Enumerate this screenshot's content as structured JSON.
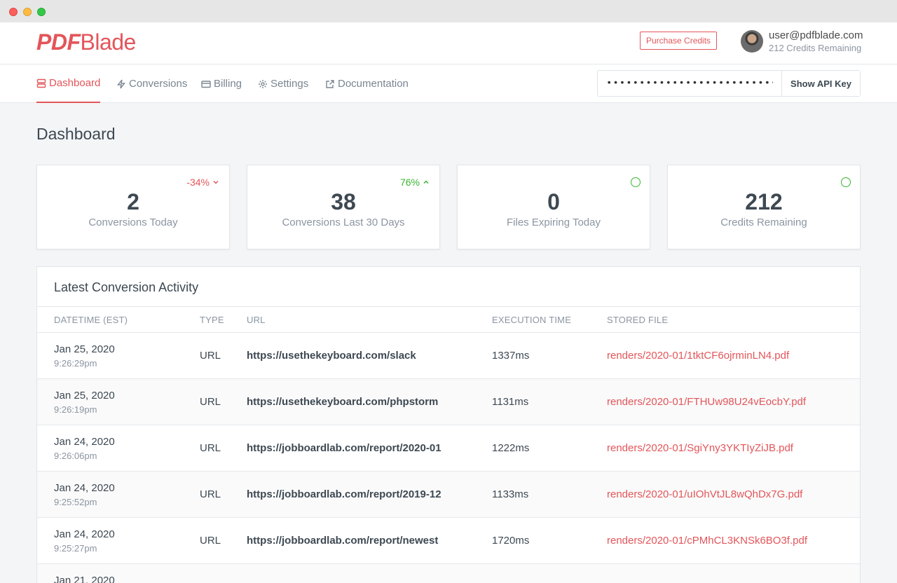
{
  "brand": {
    "part1": "PDF",
    "part2": "Blade"
  },
  "header": {
    "purchase_label": "Purchase Credits",
    "user_email": "user@pdfblade.com",
    "user_credits": "212 Credits Remaining"
  },
  "nav": {
    "items": [
      {
        "label": "Dashboard",
        "icon": "server-icon"
      },
      {
        "label": "Conversions",
        "icon": "bolt-icon"
      },
      {
        "label": "Billing",
        "icon": "credit-card-icon"
      },
      {
        "label": "Settings",
        "icon": "gear-icon"
      },
      {
        "label": "Documentation",
        "icon": "external-link-icon"
      }
    ],
    "api_key_masked": "••••••••••••••••••••••••••••••••",
    "show_api_key_label": "Show API Key"
  },
  "page_title": "Dashboard",
  "stats": [
    {
      "value": "2",
      "label": "Conversions Today",
      "trend": "-34%",
      "trend_dir": "down"
    },
    {
      "value": "38",
      "label": "Conversions Last 30 Days",
      "trend": "76%",
      "trend_dir": "up"
    },
    {
      "value": "0",
      "label": "Files Expiring Today",
      "status": "ok"
    },
    {
      "value": "212",
      "label": "Credits Remaining",
      "status": "ok"
    }
  ],
  "activity": {
    "title": "Latest Conversion Activity",
    "columns": [
      "Datetime (EST)",
      "Type",
      "URL",
      "Execution Time",
      "Stored File"
    ],
    "rows": [
      {
        "date": "Jan 25, 2020",
        "time": "9:26:29pm",
        "type": "URL",
        "url": "https://usethekeyboard.com/slack",
        "exec": "1337ms",
        "file": "renders/2020-01/1tktCF6ojrminLN4.pdf"
      },
      {
        "date": "Jan 25, 2020",
        "time": "9:26:19pm",
        "type": "URL",
        "url": "https://usethekeyboard.com/phpstorm",
        "exec": "1131ms",
        "file": "renders/2020-01/FTHUw98U24vEocbY.pdf"
      },
      {
        "date": "Jan 24, 2020",
        "time": "9:26:06pm",
        "type": "URL",
        "url": "https://jobboardlab.com/report/2020-01",
        "exec": "1222ms",
        "file": "renders/2020-01/SgiYny3YKTIyZiJB.pdf"
      },
      {
        "date": "Jan 24, 2020",
        "time": "9:25:52pm",
        "type": "URL",
        "url": "https://jobboardlab.com/report/2019-12",
        "exec": "1133ms",
        "file": "renders/2020-01/uIOhVtJL8wQhDx7G.pdf"
      },
      {
        "date": "Jan 24, 2020",
        "time": "9:25:27pm",
        "type": "URL",
        "url": "https://jobboardlab.com/report/newest",
        "exec": "1720ms",
        "file": "renders/2020-01/cPMhCL3KNSk6BO3f.pdf"
      },
      {
        "date": "Jan 21, 2020",
        "time": "",
        "type": "",
        "url": "",
        "exec": "",
        "file": ""
      }
    ]
  },
  "colors": {
    "accent": "#e3555a",
    "success": "#38b52f",
    "muted": "#8b95a1"
  }
}
